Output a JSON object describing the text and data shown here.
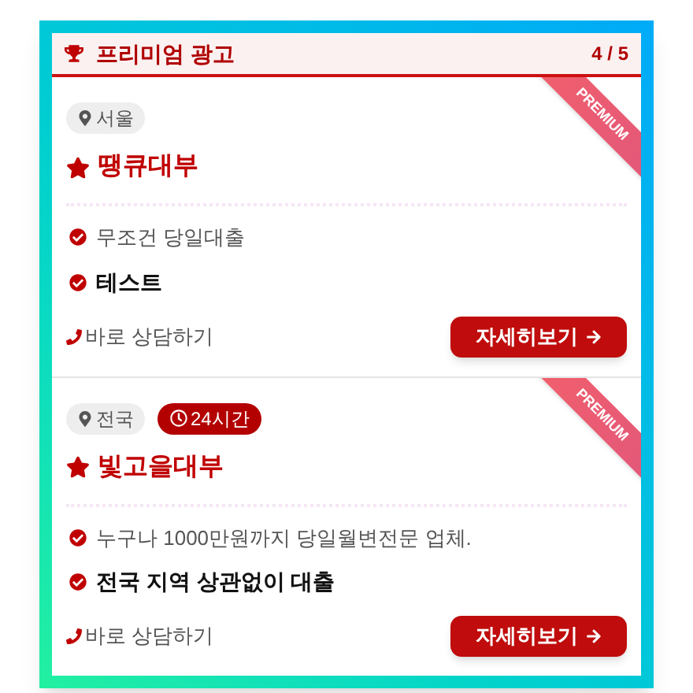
{
  "header": {
    "title": "프리미엄 광고",
    "counter": "4 / 5"
  },
  "listings": [
    {
      "ribbon": "PREMIUM",
      "badges": [
        {
          "kind": "location",
          "label": "서울"
        }
      ],
      "name": "땡큐대부",
      "features": [
        {
          "kind": "plain",
          "text": "무조건 당일대출"
        },
        {
          "kind": "bold",
          "text": "테스트"
        }
      ],
      "contact": "바로 상담하기",
      "button": "자세히보기"
    },
    {
      "ribbon": "PREMIUM",
      "badges": [
        {
          "kind": "location",
          "label": "전국"
        },
        {
          "kind": "hours",
          "label": "24시간"
        }
      ],
      "name": "빛고을대부",
      "features": [
        {
          "kind": "plain",
          "text": "누구나 1000만원까지 당일월변전문 업체."
        },
        {
          "kind": "bold",
          "text": "전국 지역 상관없이 대출"
        }
      ],
      "contact": "바로 상담하기",
      "button": "자세히보기"
    }
  ]
}
